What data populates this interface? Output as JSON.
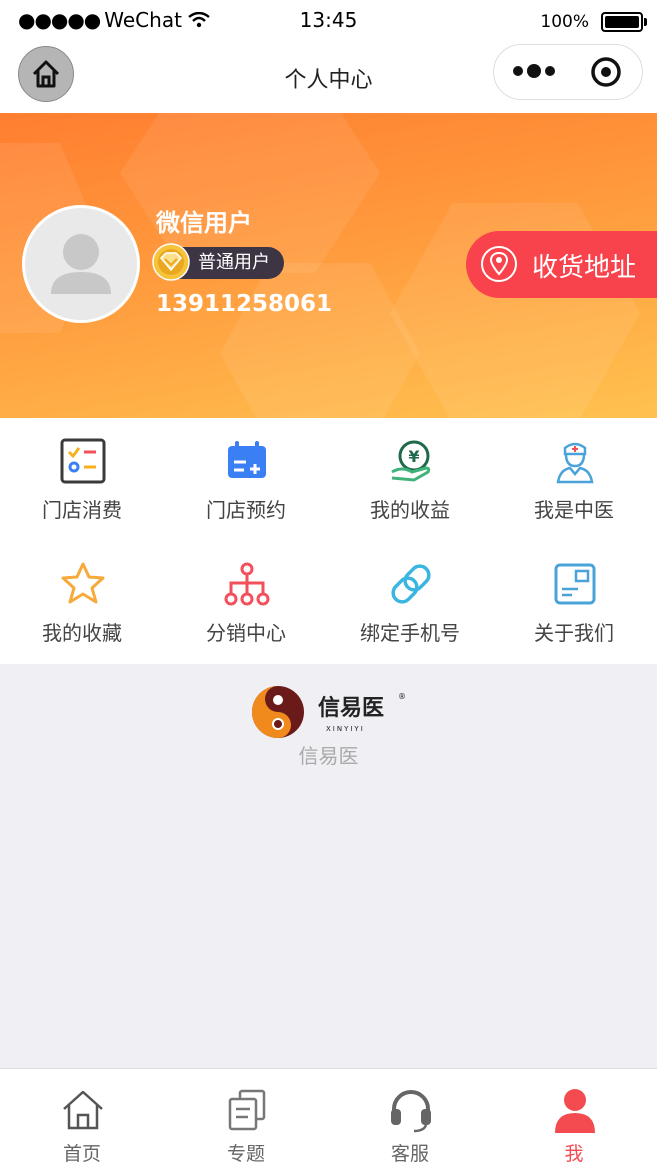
{
  "status_bar": {
    "signal_dots": "●●●●●",
    "carrier": "WeChat",
    "time": "13:45",
    "battery": "100%"
  },
  "nav": {
    "title": "个人中心"
  },
  "profile": {
    "name": "微信用户",
    "level": "普通用户",
    "phone": "13911258061",
    "address_button": "收货地址"
  },
  "grid": [
    {
      "label": "门店消费",
      "icon": "checklist-icon",
      "color": "#3a3a3a"
    },
    {
      "label": "门店预约",
      "icon": "calendar-icon",
      "color": "#3b7ff5"
    },
    {
      "label": "我的收益",
      "icon": "yuan-hand-icon",
      "color": "#1e6a4a"
    },
    {
      "label": "我是中医",
      "icon": "doctor-icon",
      "color": "#4aa3d8"
    },
    {
      "label": "我的收藏",
      "icon": "star-icon",
      "color": "#f7a93a"
    },
    {
      "label": "分销中心",
      "icon": "network-icon",
      "color": "#f2505a"
    },
    {
      "label": "绑定手机号",
      "icon": "link-icon",
      "color": "#3bb6e0"
    },
    {
      "label": "关于我们",
      "icon": "card-icon",
      "color": "#4aa3d8"
    }
  ],
  "logo": {
    "brand_text": "信易医",
    "brand_pinyin": "XINYIYI",
    "caption": "信易医"
  },
  "tabbar": [
    {
      "label": "首页",
      "icon": "home-icon",
      "active": false
    },
    {
      "label": "专题",
      "icon": "topics-icon",
      "active": false
    },
    {
      "label": "客服",
      "icon": "headset-icon",
      "active": false
    },
    {
      "label": "我",
      "icon": "user-icon",
      "active": true
    }
  ],
  "colors": {
    "banner_start": "#ff7e30",
    "banner_end": "#ffc24f",
    "accent_red": "#f44b50",
    "address_red": "#f8424c"
  }
}
